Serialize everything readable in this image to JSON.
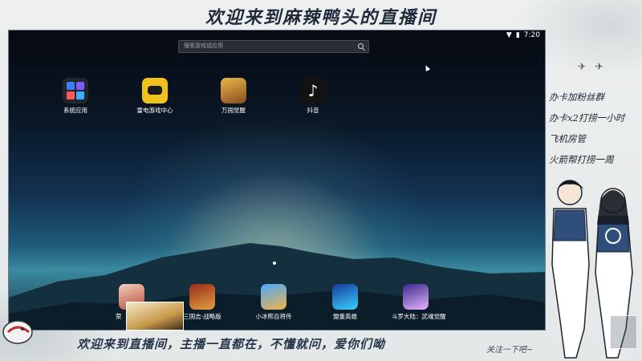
{
  "overlay": {
    "top_title": "欢迎来到麻辣鸭头的直播间",
    "bottom_message": "欢迎来到直播间，主播一直都在，不懂就问，爱你们呦",
    "follow_text": "关注一下吧~",
    "side_list": [
      "办卡加粉丝群",
      "办卡x2打捞一小时",
      "飞机房管",
      "火箭帮打捞一周"
    ]
  },
  "emulator": {
    "status": {
      "time": "7:20"
    },
    "search": {
      "placeholder": "搜索游戏或应用"
    },
    "top_apps": [
      {
        "label": "系统应用",
        "icon": "system-apps-icon"
      },
      {
        "label": "雷电游戏中心",
        "icon": "gamepad-icon"
      },
      {
        "label": "万国觉醒",
        "icon": "game-wanguo-icon"
      },
      {
        "label": "抖音",
        "icon": "tiktok-icon"
      }
    ],
    "dock_apps": [
      {
        "label": "荣",
        "icon": "game-rongyao-icon"
      },
      {
        "label": "三国志·战略版",
        "icon": "game-sanguo-icon"
      },
      {
        "label": "小冰熊百将传",
        "icon": "game-xiaobingxiong-icon"
      },
      {
        "label": "盟重英雄",
        "icon": "game-mengzhong-icon"
      },
      {
        "label": "斗罗大陆：武魂觉醒",
        "icon": "game-douluo-icon"
      }
    ]
  }
}
